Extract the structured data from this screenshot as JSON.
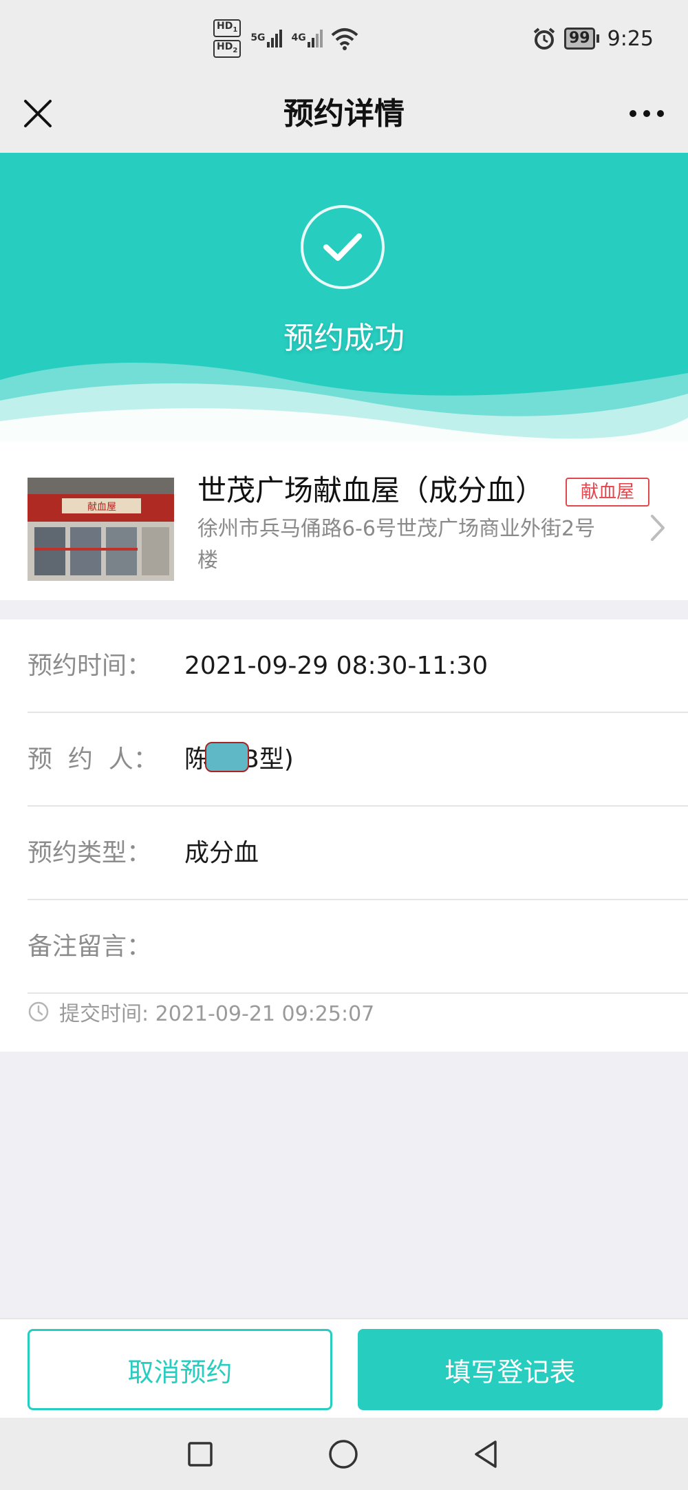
{
  "status_bar": {
    "hd1": "HD",
    "hd1_sub": "1",
    "hd2": "HD",
    "hd2_sub": "2",
    "network1": "5G",
    "network2": "4G",
    "battery": "99",
    "time": "9:25"
  },
  "nav": {
    "title": "预约详情"
  },
  "result": {
    "status_text": "预约成功",
    "accent_color": "#27cdbf"
  },
  "venue": {
    "name": "世茂广场献血屋（成分血）",
    "tag": "献血屋",
    "address": "徐州市兵马俑路6-6号世茂广场商业外街2号楼",
    "tag_color": "#e0464b"
  },
  "details": {
    "rows": [
      {
        "label": "预约时间：",
        "value": "2021-09-29 08:30-11:30"
      },
      {
        "label": "预  约  人：",
        "value_prefix": "陈",
        "value_suffix": "B型)"
      },
      {
        "label": "预约类型：",
        "value": "成分血"
      },
      {
        "label": "备注留言：",
        "value": ""
      }
    ],
    "submit_time": "提交时间: 2021-09-21 09:25:07"
  },
  "actions": {
    "cancel_label": "取消预约",
    "register_label": "填写登记表"
  }
}
